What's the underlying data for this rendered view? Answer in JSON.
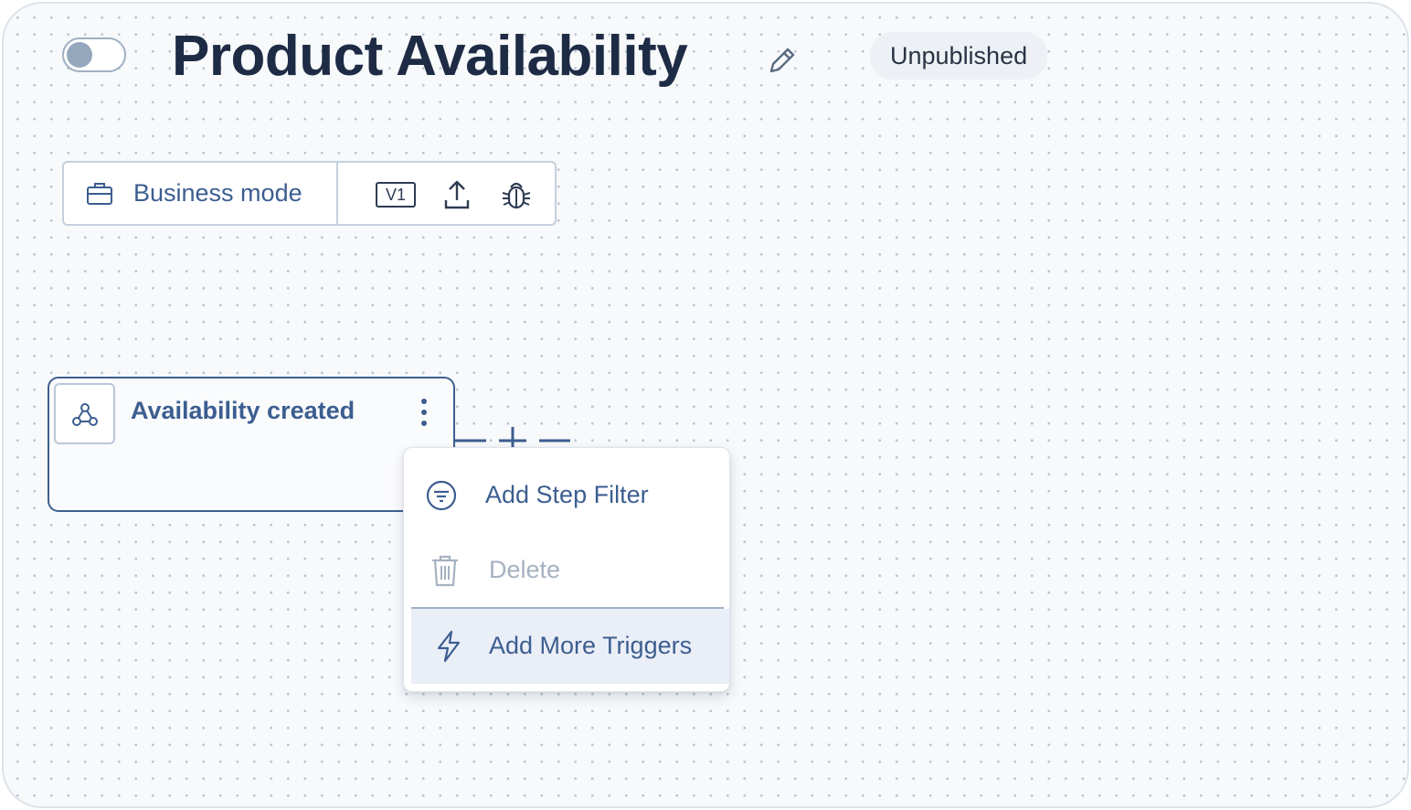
{
  "header": {
    "title": "Product Availability",
    "status_badge": "Unpublished",
    "toggle_on": false,
    "edit_icon": "pencil-icon"
  },
  "toolbar": {
    "mode_label": "Business mode",
    "mode_icon": "briefcase-icon",
    "version_label": "V1",
    "export_icon": "upload-icon",
    "debug_icon": "bug-icon"
  },
  "node": {
    "title": "Availability created",
    "icon": "webhook-icon",
    "menu_icon": "kebab-menu-icon"
  },
  "context_menu": {
    "items": [
      {
        "label": "Add Step Filter",
        "icon": "filter-icon",
        "enabled": true
      },
      {
        "label": "Delete",
        "icon": "trash-icon",
        "enabled": false
      },
      {
        "label": "Add More Triggers",
        "icon": "lightning-icon",
        "enabled": true,
        "highlighted": true
      }
    ]
  },
  "colors": {
    "title": "#1e2b45",
    "accent": "#3c5e90",
    "disabled": "#a6b2c1",
    "canvas_bg": "#f7f9fb",
    "highlight_bg": "#eaeef6"
  }
}
